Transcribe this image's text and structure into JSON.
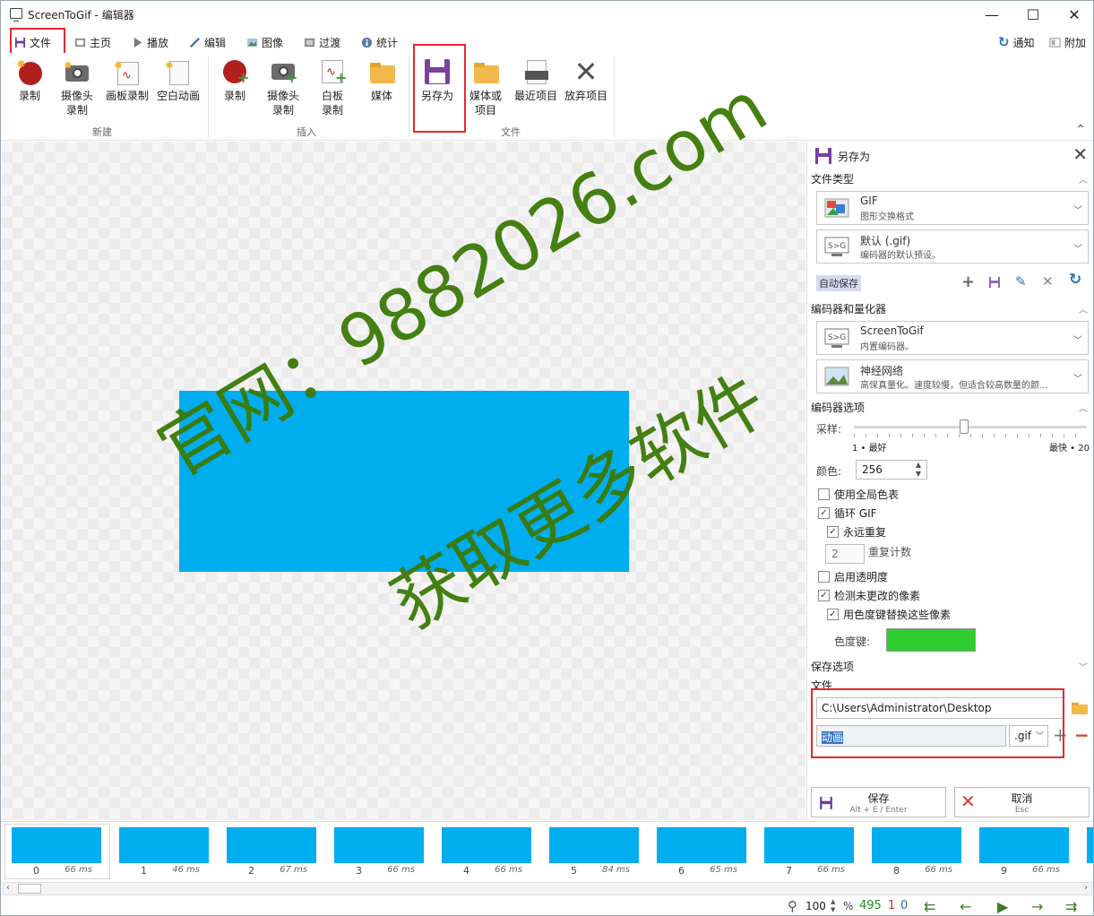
{
  "title": "ScreenToGif - 编辑器",
  "menu": {
    "file": "文件",
    "home": "主页",
    "play": "播放",
    "edit": "编辑",
    "image": "图像",
    "transitions": "过渡",
    "stats": "统计",
    "notify": "通知",
    "extras": "附加"
  },
  "ribbon": {
    "new": {
      "label": "新建",
      "record": "录制",
      "webcam1": "摄像头",
      "webcam2": "录制",
      "board": "画板录制",
      "blank": "空白动画"
    },
    "insert": {
      "label": "插入",
      "record": "录制",
      "webcam1": "摄像头",
      "webcam2": "录制",
      "whiteboard1": "白板",
      "whiteboard2": "录制",
      "media": "媒体"
    },
    "file": {
      "label": "文件",
      "saveas": "另存为",
      "media1": "媒体或",
      "media2": "项目",
      "recent": "最近项目",
      "discard": "放弃项目"
    }
  },
  "watermark": {
    "line1": "官网：9882026.com",
    "line2": "获取更多软件"
  },
  "panel": {
    "title": "另存为",
    "filetype": "文件类型",
    "gif_title": "GIF",
    "gif_sub": "图形交换格式",
    "preset_title": "默认 (.gif)",
    "preset_sub": "编码器的默认预设。",
    "autosave": "自动保存",
    "encoder_section": "编码器和量化器",
    "enc_title": "ScreenToGif",
    "enc_sub": "内置编码器。",
    "quant_title": "神经网络",
    "quant_sub": "高保真量化。速度较慢，但适合较高数量的颜…",
    "encoder_options": "编码器选项",
    "sampling": "采样:",
    "best": "1 • 最好",
    "fastest": "最快 • 20",
    "colors_label": "颜色:",
    "colors": "256",
    "global_palette": "使用全局色表",
    "loop": "循环 GIF",
    "forever": "永远重复",
    "repeat_value": "2",
    "repeat_label": "重复计数",
    "transparency": "启用透明度",
    "detect": "检测未更改的像素",
    "chroma": "用色度键替换这些像素",
    "chroma_label": "色度键:",
    "save_options": "保存选项",
    "file_label": "文件",
    "path": "C:\\Users\\Administrator\\Desktop",
    "filename": "动画",
    "ext": ".gif",
    "save": "保存",
    "save_hint": "Alt + E / Enter",
    "cancel": "取消",
    "cancel_hint": "Esc"
  },
  "frames": [
    {
      "i": "0",
      "ms": "66 ms"
    },
    {
      "i": "1",
      "ms": "46 ms"
    },
    {
      "i": "2",
      "ms": "67 ms"
    },
    {
      "i": "3",
      "ms": "66 ms"
    },
    {
      "i": "4",
      "ms": "66 ms"
    },
    {
      "i": "5",
      "ms": "84 ms"
    },
    {
      "i": "6",
      "ms": "65 ms"
    },
    {
      "i": "7",
      "ms": "66 ms"
    },
    {
      "i": "8",
      "ms": "66 ms"
    },
    {
      "i": "9",
      "ms": "66 ms"
    }
  ],
  "status": {
    "zoom": "100",
    "pct": "%",
    "total": "495",
    "selected": "1",
    "index": "0"
  },
  "colors": {
    "frame": "#00adef",
    "chroma": "#2ecc2e",
    "accent": "#7b3fa0",
    "highlight": "#e8262f",
    "watermark": "#3c7a06"
  }
}
